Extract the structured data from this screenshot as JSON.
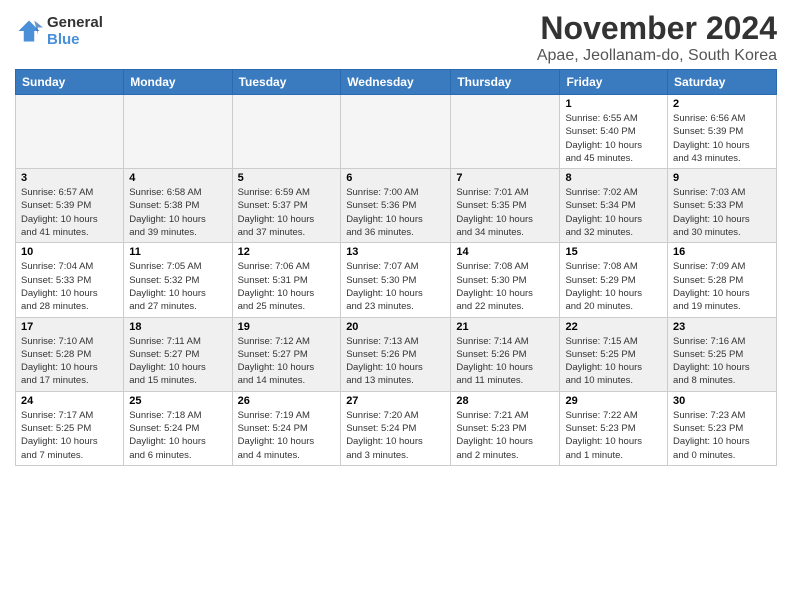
{
  "logo": {
    "line1": "General",
    "line2": "Blue"
  },
  "title": "November 2024",
  "location": "Apae, Jeollanam-do, South Korea",
  "weekdays": [
    "Sunday",
    "Monday",
    "Tuesday",
    "Wednesday",
    "Thursday",
    "Friday",
    "Saturday"
  ],
  "weeks": [
    [
      {
        "day": "",
        "info": ""
      },
      {
        "day": "",
        "info": ""
      },
      {
        "day": "",
        "info": ""
      },
      {
        "day": "",
        "info": ""
      },
      {
        "day": "",
        "info": ""
      },
      {
        "day": "1",
        "info": "Sunrise: 6:55 AM\nSunset: 5:40 PM\nDaylight: 10 hours\nand 45 minutes."
      },
      {
        "day": "2",
        "info": "Sunrise: 6:56 AM\nSunset: 5:39 PM\nDaylight: 10 hours\nand 43 minutes."
      }
    ],
    [
      {
        "day": "3",
        "info": "Sunrise: 6:57 AM\nSunset: 5:39 PM\nDaylight: 10 hours\nand 41 minutes."
      },
      {
        "day": "4",
        "info": "Sunrise: 6:58 AM\nSunset: 5:38 PM\nDaylight: 10 hours\nand 39 minutes."
      },
      {
        "day": "5",
        "info": "Sunrise: 6:59 AM\nSunset: 5:37 PM\nDaylight: 10 hours\nand 37 minutes."
      },
      {
        "day": "6",
        "info": "Sunrise: 7:00 AM\nSunset: 5:36 PM\nDaylight: 10 hours\nand 36 minutes."
      },
      {
        "day": "7",
        "info": "Sunrise: 7:01 AM\nSunset: 5:35 PM\nDaylight: 10 hours\nand 34 minutes."
      },
      {
        "day": "8",
        "info": "Sunrise: 7:02 AM\nSunset: 5:34 PM\nDaylight: 10 hours\nand 32 minutes."
      },
      {
        "day": "9",
        "info": "Sunrise: 7:03 AM\nSunset: 5:33 PM\nDaylight: 10 hours\nand 30 minutes."
      }
    ],
    [
      {
        "day": "10",
        "info": "Sunrise: 7:04 AM\nSunset: 5:33 PM\nDaylight: 10 hours\nand 28 minutes."
      },
      {
        "day": "11",
        "info": "Sunrise: 7:05 AM\nSunset: 5:32 PM\nDaylight: 10 hours\nand 27 minutes."
      },
      {
        "day": "12",
        "info": "Sunrise: 7:06 AM\nSunset: 5:31 PM\nDaylight: 10 hours\nand 25 minutes."
      },
      {
        "day": "13",
        "info": "Sunrise: 7:07 AM\nSunset: 5:30 PM\nDaylight: 10 hours\nand 23 minutes."
      },
      {
        "day": "14",
        "info": "Sunrise: 7:08 AM\nSunset: 5:30 PM\nDaylight: 10 hours\nand 22 minutes."
      },
      {
        "day": "15",
        "info": "Sunrise: 7:08 AM\nSunset: 5:29 PM\nDaylight: 10 hours\nand 20 minutes."
      },
      {
        "day": "16",
        "info": "Sunrise: 7:09 AM\nSunset: 5:28 PM\nDaylight: 10 hours\nand 19 minutes."
      }
    ],
    [
      {
        "day": "17",
        "info": "Sunrise: 7:10 AM\nSunset: 5:28 PM\nDaylight: 10 hours\nand 17 minutes."
      },
      {
        "day": "18",
        "info": "Sunrise: 7:11 AM\nSunset: 5:27 PM\nDaylight: 10 hours\nand 15 minutes."
      },
      {
        "day": "19",
        "info": "Sunrise: 7:12 AM\nSunset: 5:27 PM\nDaylight: 10 hours\nand 14 minutes."
      },
      {
        "day": "20",
        "info": "Sunrise: 7:13 AM\nSunset: 5:26 PM\nDaylight: 10 hours\nand 13 minutes."
      },
      {
        "day": "21",
        "info": "Sunrise: 7:14 AM\nSunset: 5:26 PM\nDaylight: 10 hours\nand 11 minutes."
      },
      {
        "day": "22",
        "info": "Sunrise: 7:15 AM\nSunset: 5:25 PM\nDaylight: 10 hours\nand 10 minutes."
      },
      {
        "day": "23",
        "info": "Sunrise: 7:16 AM\nSunset: 5:25 PM\nDaylight: 10 hours\nand 8 minutes."
      }
    ],
    [
      {
        "day": "24",
        "info": "Sunrise: 7:17 AM\nSunset: 5:25 PM\nDaylight: 10 hours\nand 7 minutes."
      },
      {
        "day": "25",
        "info": "Sunrise: 7:18 AM\nSunset: 5:24 PM\nDaylight: 10 hours\nand 6 minutes."
      },
      {
        "day": "26",
        "info": "Sunrise: 7:19 AM\nSunset: 5:24 PM\nDaylight: 10 hours\nand 4 minutes."
      },
      {
        "day": "27",
        "info": "Sunrise: 7:20 AM\nSunset: 5:24 PM\nDaylight: 10 hours\nand 3 minutes."
      },
      {
        "day": "28",
        "info": "Sunrise: 7:21 AM\nSunset: 5:23 PM\nDaylight: 10 hours\nand 2 minutes."
      },
      {
        "day": "29",
        "info": "Sunrise: 7:22 AM\nSunset: 5:23 PM\nDaylight: 10 hours\nand 1 minute."
      },
      {
        "day": "30",
        "info": "Sunrise: 7:23 AM\nSunset: 5:23 PM\nDaylight: 10 hours\nand 0 minutes."
      }
    ]
  ]
}
